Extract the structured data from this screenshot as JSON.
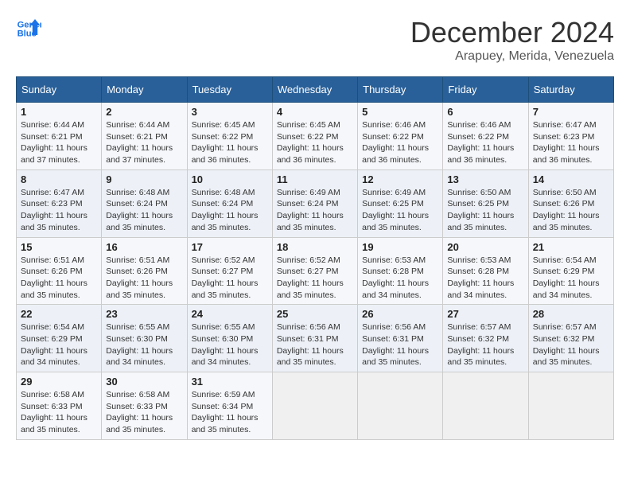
{
  "header": {
    "logo_line1": "General",
    "logo_line2": "Blue",
    "month_title": "December 2024",
    "location": "Arapuey, Merida, Venezuela"
  },
  "weekdays": [
    "Sunday",
    "Monday",
    "Tuesday",
    "Wednesday",
    "Thursday",
    "Friday",
    "Saturday"
  ],
  "weeks": [
    [
      {
        "day": "1",
        "sunrise": "6:44 AM",
        "sunset": "6:21 PM",
        "daylight": "11 hours and 37 minutes."
      },
      {
        "day": "2",
        "sunrise": "6:44 AM",
        "sunset": "6:21 PM",
        "daylight": "11 hours and 37 minutes."
      },
      {
        "day": "3",
        "sunrise": "6:45 AM",
        "sunset": "6:22 PM",
        "daylight": "11 hours and 36 minutes."
      },
      {
        "day": "4",
        "sunrise": "6:45 AM",
        "sunset": "6:22 PM",
        "daylight": "11 hours and 36 minutes."
      },
      {
        "day": "5",
        "sunrise": "6:46 AM",
        "sunset": "6:22 PM",
        "daylight": "11 hours and 36 minutes."
      },
      {
        "day": "6",
        "sunrise": "6:46 AM",
        "sunset": "6:22 PM",
        "daylight": "11 hours and 36 minutes."
      },
      {
        "day": "7",
        "sunrise": "6:47 AM",
        "sunset": "6:23 PM",
        "daylight": "11 hours and 36 minutes."
      }
    ],
    [
      {
        "day": "8",
        "sunrise": "6:47 AM",
        "sunset": "6:23 PM",
        "daylight": "11 hours and 35 minutes."
      },
      {
        "day": "9",
        "sunrise": "6:48 AM",
        "sunset": "6:24 PM",
        "daylight": "11 hours and 35 minutes."
      },
      {
        "day": "10",
        "sunrise": "6:48 AM",
        "sunset": "6:24 PM",
        "daylight": "11 hours and 35 minutes."
      },
      {
        "day": "11",
        "sunrise": "6:49 AM",
        "sunset": "6:24 PM",
        "daylight": "11 hours and 35 minutes."
      },
      {
        "day": "12",
        "sunrise": "6:49 AM",
        "sunset": "6:25 PM",
        "daylight": "11 hours and 35 minutes."
      },
      {
        "day": "13",
        "sunrise": "6:50 AM",
        "sunset": "6:25 PM",
        "daylight": "11 hours and 35 minutes."
      },
      {
        "day": "14",
        "sunrise": "6:50 AM",
        "sunset": "6:26 PM",
        "daylight": "11 hours and 35 minutes."
      }
    ],
    [
      {
        "day": "15",
        "sunrise": "6:51 AM",
        "sunset": "6:26 PM",
        "daylight": "11 hours and 35 minutes."
      },
      {
        "day": "16",
        "sunrise": "6:51 AM",
        "sunset": "6:26 PM",
        "daylight": "11 hours and 35 minutes."
      },
      {
        "day": "17",
        "sunrise": "6:52 AM",
        "sunset": "6:27 PM",
        "daylight": "11 hours and 35 minutes."
      },
      {
        "day": "18",
        "sunrise": "6:52 AM",
        "sunset": "6:27 PM",
        "daylight": "11 hours and 35 minutes."
      },
      {
        "day": "19",
        "sunrise": "6:53 AM",
        "sunset": "6:28 PM",
        "daylight": "11 hours and 34 minutes."
      },
      {
        "day": "20",
        "sunrise": "6:53 AM",
        "sunset": "6:28 PM",
        "daylight": "11 hours and 34 minutes."
      },
      {
        "day": "21",
        "sunrise": "6:54 AM",
        "sunset": "6:29 PM",
        "daylight": "11 hours and 34 minutes."
      }
    ],
    [
      {
        "day": "22",
        "sunrise": "6:54 AM",
        "sunset": "6:29 PM",
        "daylight": "11 hours and 34 minutes."
      },
      {
        "day": "23",
        "sunrise": "6:55 AM",
        "sunset": "6:30 PM",
        "daylight": "11 hours and 34 minutes."
      },
      {
        "day": "24",
        "sunrise": "6:55 AM",
        "sunset": "6:30 PM",
        "daylight": "11 hours and 34 minutes."
      },
      {
        "day": "25",
        "sunrise": "6:56 AM",
        "sunset": "6:31 PM",
        "daylight": "11 hours and 35 minutes."
      },
      {
        "day": "26",
        "sunrise": "6:56 AM",
        "sunset": "6:31 PM",
        "daylight": "11 hours and 35 minutes."
      },
      {
        "day": "27",
        "sunrise": "6:57 AM",
        "sunset": "6:32 PM",
        "daylight": "11 hours and 35 minutes."
      },
      {
        "day": "28",
        "sunrise": "6:57 AM",
        "sunset": "6:32 PM",
        "daylight": "11 hours and 35 minutes."
      }
    ],
    [
      {
        "day": "29",
        "sunrise": "6:58 AM",
        "sunset": "6:33 PM",
        "daylight": "11 hours and 35 minutes."
      },
      {
        "day": "30",
        "sunrise": "6:58 AM",
        "sunset": "6:33 PM",
        "daylight": "11 hours and 35 minutes."
      },
      {
        "day": "31",
        "sunrise": "6:59 AM",
        "sunset": "6:34 PM",
        "daylight": "11 hours and 35 minutes."
      },
      null,
      null,
      null,
      null
    ]
  ]
}
